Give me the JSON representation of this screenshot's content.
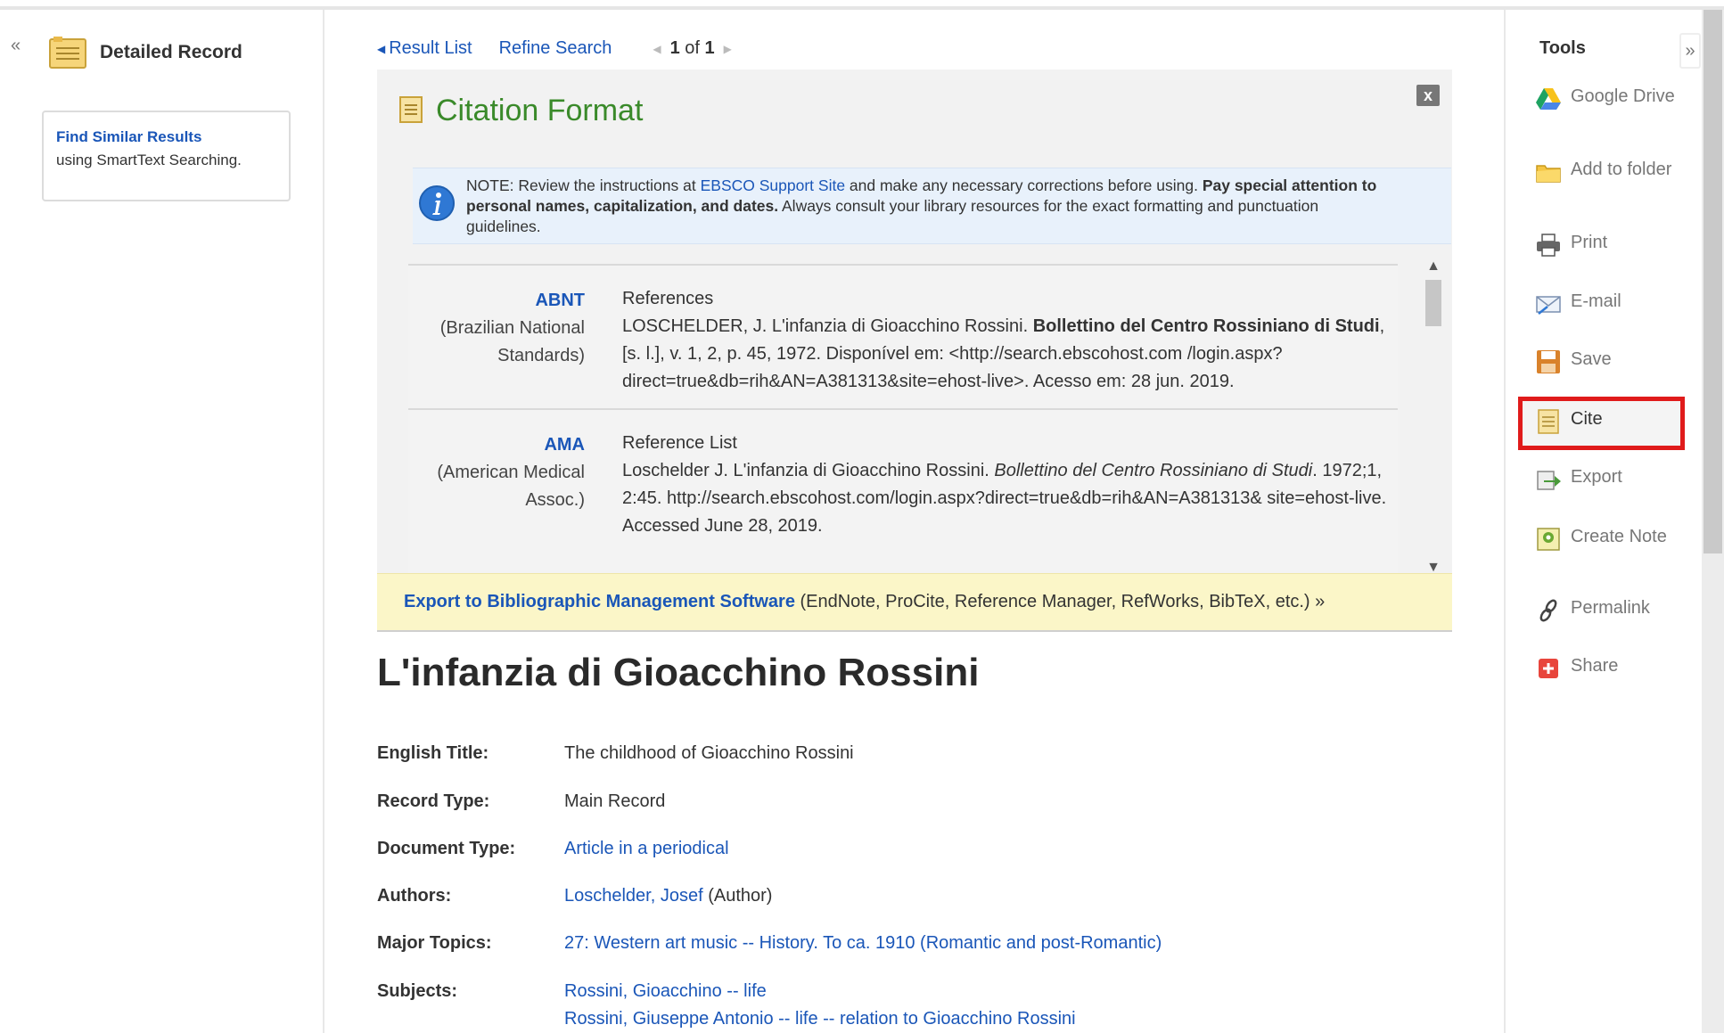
{
  "left": {
    "collapse": "«",
    "detailed_record": "Detailed Record",
    "find_similar_link": "Find Similar Results",
    "find_similar_sub": "using SmartText Searching."
  },
  "nav": {
    "result_list": "Result List",
    "refine_search": "Refine Search",
    "page_current": "1",
    "page_of": "of",
    "page_total": "1"
  },
  "citation": {
    "title": "Citation Format",
    "close": "x",
    "note_prefix": "NOTE: Review the instructions at ",
    "note_link": "EBSCO Support Site",
    "note_mid": " and make any necessary corrections before using. ",
    "note_bold": "Pay special attention to personal names, capitalization, and dates.",
    "note_suffix": " Always consult your library resources for the exact formatting and punctuation guidelines.",
    "entries": [
      {
        "code": "ABNT",
        "org": "(Brazilian National Standards)",
        "heading": "References",
        "text_a": "LOSCHELDER, J. L'infanzia di Gioacchino Rossini. ",
        "text_bold": "Bollettino del Centro Rossiniano di Studi",
        "text_b": ", [s. l.], v. 1, 2, p. 45, 1972. Disponível em: <http://search.ebscohost.com /login.aspx?direct=true&db=rih&AN=A381313&site=ehost-live>. Acesso em: 28 jun. 2019."
      },
      {
        "code": "AMA",
        "org": "(American Medical Assoc.)",
        "heading": "Reference List",
        "text_a": "Loschelder J. L'infanzia di Gioacchino Rossini. ",
        "text_italic": "Bollettino del Centro Rossiniano di Studi",
        "text_b": ". 1972;1, 2:45. http://search.ebscohost.com/login.aspx?direct=true&db=rih&AN=A381313& site=ehost-live. Accessed June 28, 2019."
      }
    ],
    "export_link": "Export to Bibliographic Management Software",
    "export_rest": " (EndNote, ProCite, Reference Manager, RefWorks, BibTeX, etc.) »"
  },
  "record": {
    "title": "L'infanzia di Gioacchino Rossini",
    "fields": [
      {
        "label": "English Title:",
        "value": "The childhood of Gioacchino Rossini"
      },
      {
        "label": "Record Type:",
        "value": "Main Record"
      },
      {
        "label": "Document Type:",
        "value": "Article in a periodical"
      },
      {
        "label": "Authors:",
        "value": "Loschelder, Josef",
        "extra": " (Author)"
      },
      {
        "label": "Major Topics:",
        "value": "27: Western art music -- History. To ca. 1910 (Romantic and post-Romantic)"
      },
      {
        "label": "Subjects:",
        "value": "Rossini, Gioacchino -- life",
        "value2": "Rossini, Giuseppe Antonio -- life -- relation to Gioacchino Rossini"
      }
    ]
  },
  "tools": {
    "title": "Tools",
    "collapse": "»",
    "items": [
      {
        "label": "Google Drive",
        "icon": "google-drive-icon"
      },
      {
        "label": "Add to folder",
        "icon": "folder-icon"
      },
      {
        "label": "Print",
        "icon": "printer-icon"
      },
      {
        "label": "E-mail",
        "icon": "email-icon"
      },
      {
        "label": "Save",
        "icon": "save-icon"
      },
      {
        "label": "Cite",
        "icon": "cite-icon"
      },
      {
        "label": "Export",
        "icon": "export-icon"
      },
      {
        "label": "Create Note",
        "icon": "note-icon"
      },
      {
        "label": "Permalink",
        "icon": "link-icon"
      },
      {
        "label": "Share",
        "icon": "share-icon"
      }
    ]
  },
  "colors": {
    "link": "#1a56b8",
    "citation_title": "#3a8a2a",
    "highlight": "#e01b1b",
    "export_bar": "#fbf6c8"
  }
}
